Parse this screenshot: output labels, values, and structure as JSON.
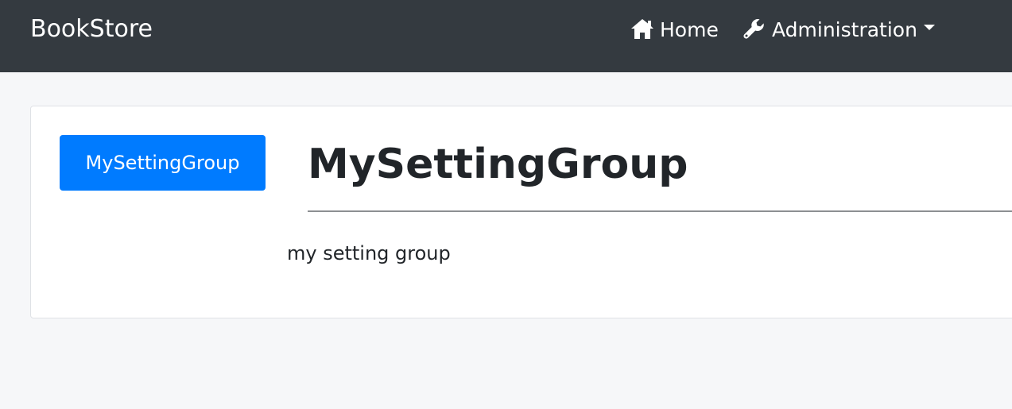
{
  "navbar": {
    "brand": "BookStore",
    "items": [
      {
        "label": "Home",
        "icon": "home-icon"
      },
      {
        "label": "Administration",
        "icon": "wrench-icon"
      }
    ]
  },
  "content": {
    "group_button_label": "MySettingGroup",
    "title": "MySettingGroup",
    "description": "my setting group"
  },
  "colors": {
    "navbar_background": "#343a40",
    "page_background": "#f6f7f9",
    "primary": "#007bff",
    "text": "#212529"
  }
}
